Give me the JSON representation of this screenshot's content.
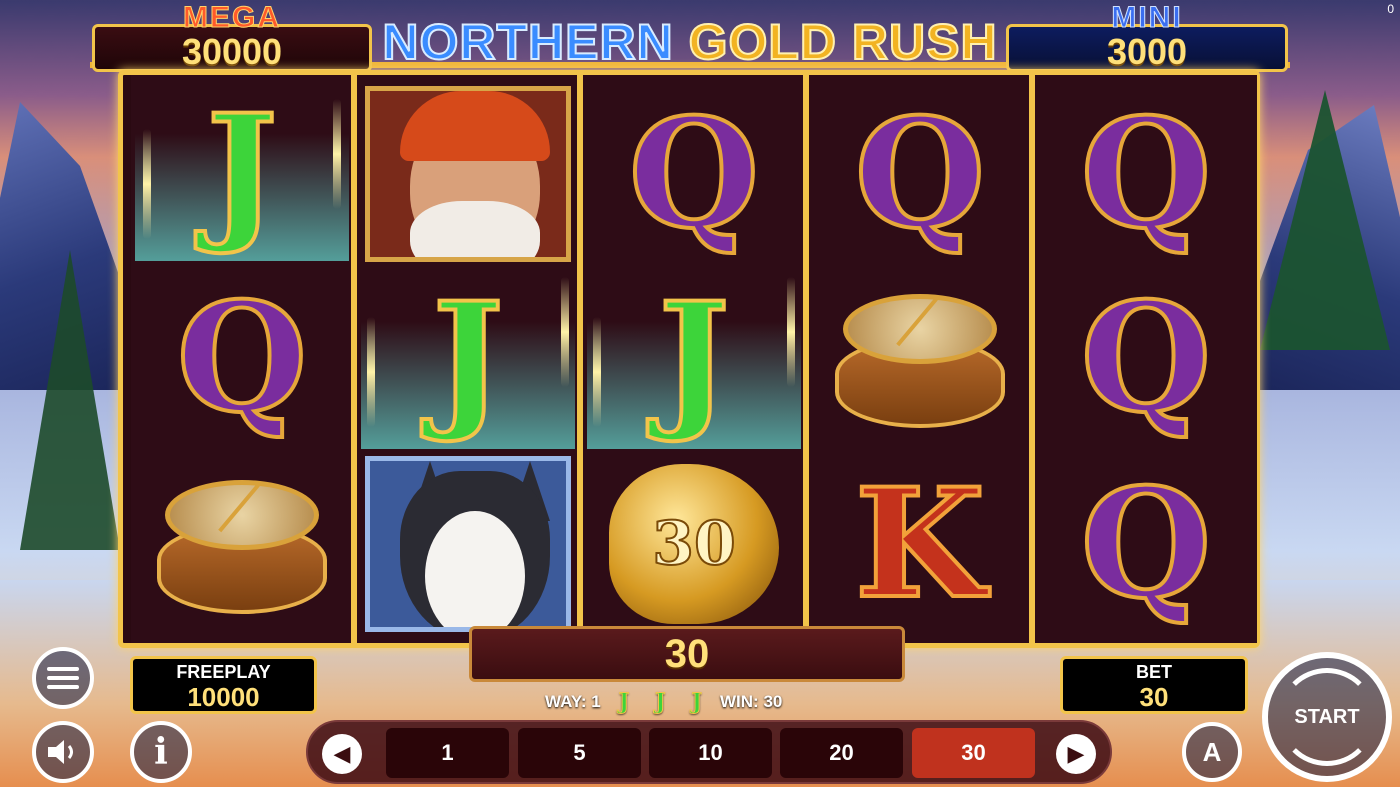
{
  "title": {
    "part1": "NORTHERN",
    "part2": "GOLD RUSH"
  },
  "jackpots": {
    "mega": {
      "label": "MEGA",
      "value": "30000"
    },
    "mini": {
      "label": "MINI",
      "value": "3000"
    }
  },
  "reels": [
    [
      "J",
      "Q",
      "compass"
    ],
    [
      "old-man",
      "J",
      "husky"
    ],
    [
      "Q",
      "J",
      "gold-nugget"
    ],
    [
      "Q",
      "compass",
      "K"
    ],
    [
      "Q",
      "Q",
      "Q"
    ]
  ],
  "nugget_value": "30",
  "win_panel": {
    "value": "30"
  },
  "way_line": {
    "way_label": "WAY: 1",
    "win_label": "WIN: 30",
    "symbol": "J"
  },
  "freeplay": {
    "label": "FREEPLAY",
    "value": "10000"
  },
  "bet": {
    "label": "BET",
    "value": "30"
  },
  "bet_options": [
    "1",
    "5",
    "10",
    "20",
    "30"
  ],
  "selected_bet": "30",
  "start_button": {
    "label": "START"
  },
  "auto_button": {
    "label": "A"
  },
  "info_button": {
    "label": "i"
  },
  "corner_counter": "0",
  "colors": {
    "frame_gold": "#f2c44a",
    "jackpot_value": "#ffe07a",
    "active_bet": "#c0321e",
    "letter_j": "#3dd43a",
    "letter_q": "#7a2d9e",
    "letter_k": "#c4321c"
  }
}
